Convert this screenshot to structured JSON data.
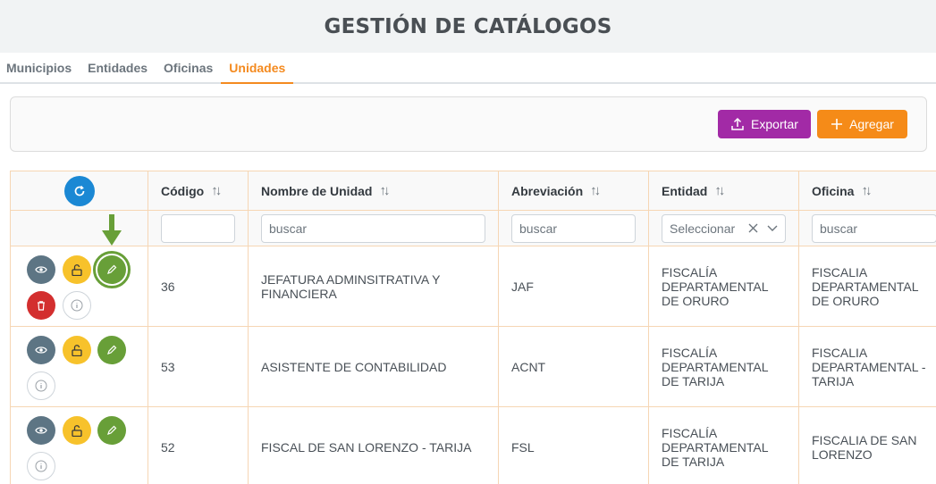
{
  "page": {
    "title": "GESTIÓN DE CATÁLOGOS"
  },
  "tabs": [
    {
      "label": "Municipios",
      "active": false
    },
    {
      "label": "Entidades",
      "active": false
    },
    {
      "label": "Oficinas",
      "active": false
    },
    {
      "label": "Unidades",
      "active": true
    }
  ],
  "toolbar": {
    "export_label": "Exportar",
    "add_label": "Agregar"
  },
  "colors": {
    "accent": "#f48a1f",
    "export": "#a22aa6",
    "add": "#f58b18",
    "view": "#5d7584",
    "unlock": "#f7c22b",
    "edit": "#689f38",
    "delete": "#d32f2f",
    "refresh": "#1b88d4"
  },
  "table": {
    "columns": [
      "Código",
      "Nombre de Unidad",
      "Abreviación",
      "Entidad",
      "Oficina"
    ],
    "filters": {
      "codigo": "",
      "nombre_placeholder": "buscar",
      "abreviacion_placeholder": "buscar",
      "entidad_placeholder": "Seleccionar",
      "oficina_placeholder": "buscar"
    },
    "rows": [
      {
        "codigo": "36",
        "nombre": [
          "JEFATURA ADMINSITRATIVA Y",
          "FINANCIERA"
        ],
        "abreviacion": "JAF",
        "entidad": [
          "FISCALÍA",
          "DEPARTAMENTAL",
          "DE ORURO"
        ],
        "oficina": [
          "FISCALIA",
          "DEPARTAMENTAL",
          "DE ORURO"
        ]
      },
      {
        "codigo": "53",
        "nombre": [
          "ASISTENTE DE CONTABILIDAD"
        ],
        "abreviacion": "ACNT",
        "entidad": [
          "FISCALÍA",
          "DEPARTAMENTAL",
          "DE TARIJA"
        ],
        "oficina": [
          "FISCALIA",
          "DEPARTAMENTAL -",
          "TARIJA"
        ]
      },
      {
        "codigo": "52",
        "nombre": [
          "FISCAL DE SAN LORENZO - TARIJA"
        ],
        "abreviacion": "FSL",
        "entidad": [
          "FISCALÍA",
          "DEPARTAMENTAL",
          "DE TARIJA"
        ],
        "oficina": [
          "FISCALIA DE SAN",
          "LORENZO"
        ]
      }
    ]
  },
  "icons": {
    "refresh": "refresh-icon",
    "view": "eye-icon",
    "unlock": "unlock-icon",
    "edit": "pencil-icon",
    "delete": "trash-icon",
    "info": "info-icon",
    "sort": "sort-icon",
    "export": "upload-icon",
    "add": "plus-icon",
    "clear": "close-icon",
    "dropdown": "chevron-down-icon",
    "pointer": "arrow-down-icon"
  }
}
